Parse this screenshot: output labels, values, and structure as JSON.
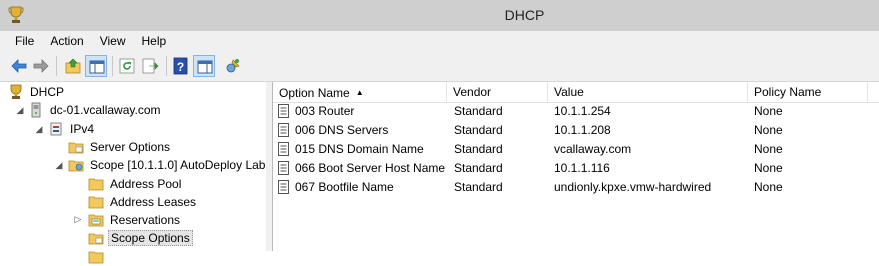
{
  "window": {
    "title": "DHCP",
    "app_icon": "dhcp-trophy-icon"
  },
  "menu": [
    "File",
    "Action",
    "View",
    "Help"
  ],
  "toolbar": {
    "buttons": [
      "back-arrow-icon",
      "forward-arrow-icon",
      "up-folder-icon",
      "show-hide-console-tree-icon",
      "refresh-icon",
      "export-list-icon",
      "help-icon",
      "show-hide-action-pane-icon",
      "dhcp-options-icon"
    ]
  },
  "tree": {
    "root": "DHCP",
    "server": "dc-01.vcallaway.com",
    "ipv4": "IPv4",
    "server_options": "Server Options",
    "scope": "Scope [10.1.1.0] AutoDeploy Lab",
    "address_pool": "Address Pool",
    "address_leases": "Address Leases",
    "reservations": "Reservations",
    "scope_options": "Scope Options"
  },
  "list": {
    "columns": [
      "Option Name",
      "Vendor",
      "Value",
      "Policy Name"
    ],
    "sorted_column": "Option Name",
    "rows": [
      {
        "name": "003 Router",
        "vendor": "Standard",
        "value": "10.1.1.254",
        "policy": "None"
      },
      {
        "name": "006 DNS Servers",
        "vendor": "Standard",
        "value": "10.1.1.208",
        "policy": "None"
      },
      {
        "name": "015 DNS Domain Name",
        "vendor": "Standard",
        "value": "vcallaway.com",
        "policy": "None"
      },
      {
        "name": "066 Boot Server Host Name",
        "vendor": "Standard",
        "value": "10.1.1.116",
        "policy": "None"
      },
      {
        "name": "067 Bootfile Name",
        "vendor": "Standard",
        "value": "undionly.kpxe.vmw-hardwired",
        "policy": "None"
      }
    ]
  },
  "colors": {
    "titlebar": "#cfcfcf",
    "chrome": "#f0f0f0",
    "folder": "#f3c85c",
    "pressed": "#cde4f7"
  }
}
